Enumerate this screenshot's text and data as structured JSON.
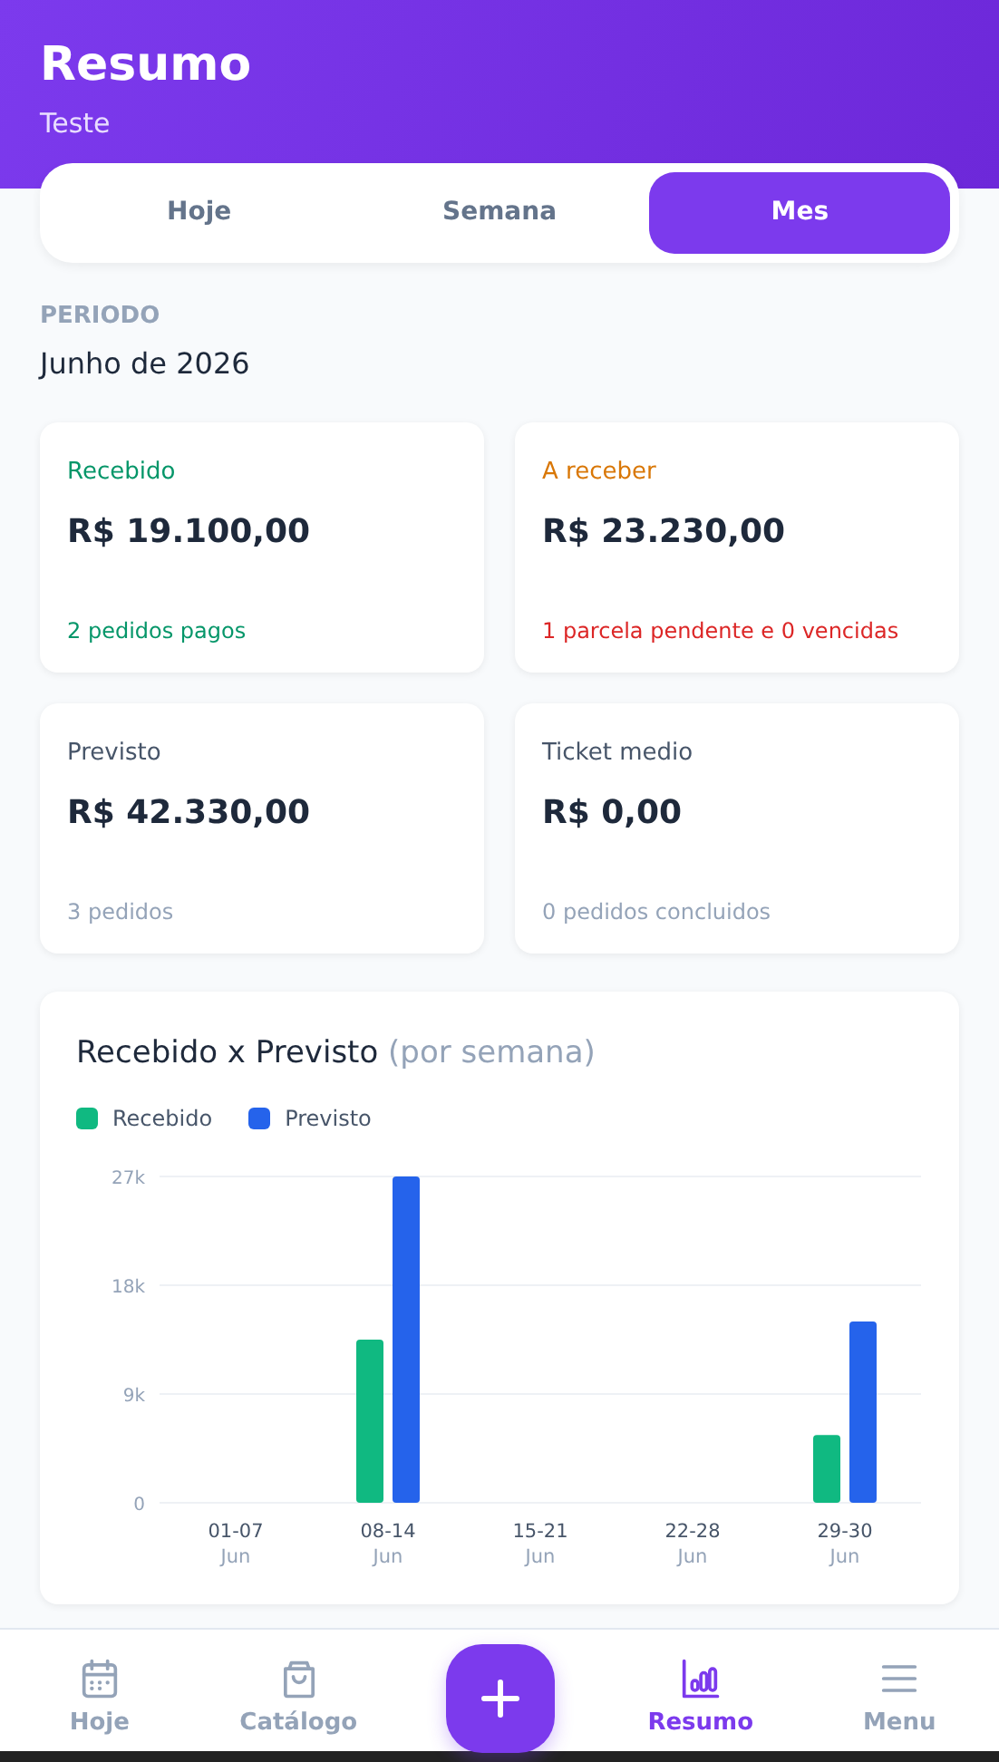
{
  "header": {
    "title": "Resumo",
    "subtitle": "Teste"
  },
  "tabs": [
    {
      "label": "Hoje",
      "selected": false
    },
    {
      "label": "Semana",
      "selected": false
    },
    {
      "label": "Mes",
      "selected": true
    }
  ],
  "period": {
    "label": "PERIODO",
    "value": "Junho de 2026"
  },
  "cards": [
    {
      "kind": "received",
      "label": "Recebido",
      "value": "R$ 19.100,00",
      "note": "2 pedidos pagos"
    },
    {
      "kind": "pending",
      "label": "A receber",
      "value": "R$ 23.230,00",
      "note": "1 parcela pendente e 0 vencidas"
    },
    {
      "kind": "neutral",
      "label": "Previsto",
      "value": "R$ 42.330,00",
      "note": "3 pedidos"
    },
    {
      "kind": "neutral",
      "label": "Ticket medio",
      "value": "R$ 0,00",
      "note": "0 pedidos concluidos"
    }
  ],
  "chart": {
    "title": "Recebido x Previsto",
    "title_note": "(por semana)",
    "chart_data": {
      "type": "bar",
      "categories": [
        "01-07 Jun",
        "08-14 Jun",
        "15-21 Jun",
        "22-28 Jun",
        "29-30 Jun"
      ],
      "series": [
        {
          "name": "Recebido",
          "color": "#10b981",
          "values": [
            0,
            13500,
            0,
            0,
            5600
          ]
        },
        {
          "name": "Previsto",
          "color": "#2563eb",
          "values": [
            0,
            27000,
            0,
            0,
            15000
          ]
        }
      ],
      "legend": "top",
      "ylim": [
        0,
        27000
      ],
      "yticks": [
        {
          "value": 0,
          "label": "0"
        },
        {
          "value": 9000,
          "label": "9k"
        },
        {
          "value": 18000,
          "label": "18k"
        },
        {
          "value": 27000,
          "label": "27k"
        }
      ]
    }
  },
  "nav": [
    {
      "kind": "calendar",
      "label": "Hoje",
      "selected": false
    },
    {
      "kind": "bag",
      "label": "Catálogo",
      "selected": false
    },
    {
      "kind": "add"
    },
    {
      "kind": "chart",
      "label": "Resumo",
      "selected": true
    },
    {
      "kind": "menu",
      "label": "Menu",
      "selected": false
    }
  ]
}
